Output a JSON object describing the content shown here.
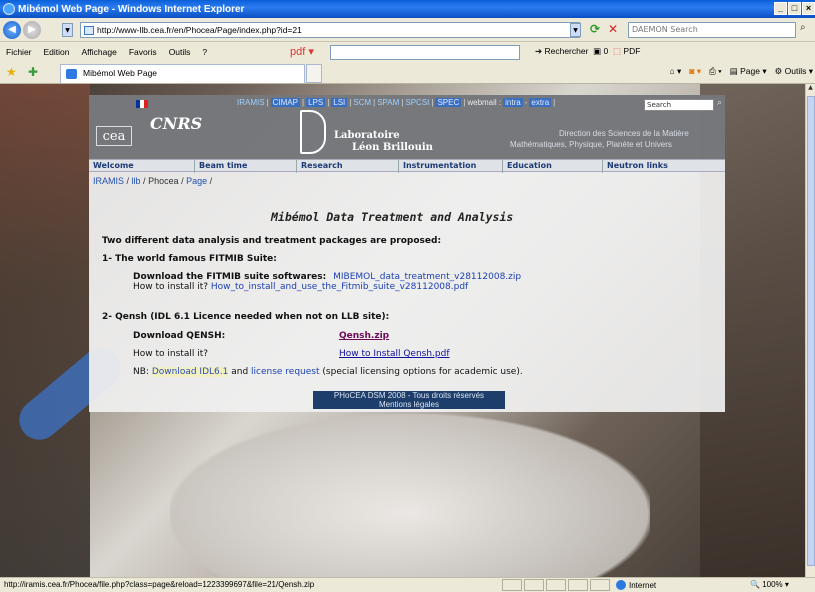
{
  "window": {
    "title": "Mibémol Web Page - Windows Internet Explorer"
  },
  "address": {
    "url": "http://www-llb.cea.fr/en/Phocea/Page/index.php?id=21",
    "search_placeholder": "DAEMON Search"
  },
  "menu": [
    "Fichier",
    "Edition",
    "Affichage",
    "Favoris",
    "Outils",
    "?"
  ],
  "pdf_label": "pdf",
  "rechercher": "Rechercher",
  "rechercher_count": "0",
  "pdf_btn": "PDF",
  "tab": {
    "title": "Mibémol Web Page"
  },
  "tools": {
    "page": "Page",
    "outils": "Outils"
  },
  "site_nav": {
    "links": [
      "IRAMIS",
      "CIMAP",
      "LPS",
      "LSI",
      "SCM",
      "SPAM",
      "SPCSI",
      "SPEC"
    ],
    "webmail": "webmail :",
    "intra": "intra",
    "extra": "extra",
    "search_value": "Search"
  },
  "header": {
    "cea": "cea",
    "cnrs": "CNRS",
    "lab_line1": "Laboratoire",
    "lab_line2": "Léon Brillouin",
    "dir_line1": "Direction des Sciences de la Matière",
    "dir_line2": "Mathématiques, Physique, Planète et Univers"
  },
  "main_nav": [
    "Welcome",
    "Beam time",
    "Research",
    "Instrumentation",
    "Education",
    "Neutron links"
  ],
  "breadcrumb": {
    "iramis": "IRAMIS",
    "llb": "llb",
    "phocea": "Phocea",
    "page": "Page"
  },
  "content": {
    "title": "Mibémol Data Treatment and Analysis",
    "intro": "Two different data analysis and treatment packages are proposed:",
    "sec1": "1- The world famous FITMIB Suite:",
    "download_fitmib_label": "Download the FITMIB suite softwares:",
    "download_fitmib_link": "MIBEMOL_data_treatment_v28112008.zip",
    "install_q1": "How to install it?",
    "install_link1": "How_to_install_and_use_the_Fitmib_suite_v28112008.pdf",
    "sec2": "2- Qensh (IDL 6.1 Licence needed when not on LLB site):",
    "download_qensh_label": "Download QENSH:",
    "qensh_link": "Qensh.zip",
    "install_q2": "How to install it?",
    "install_link2": "How to Install Qensh.pdf",
    "nb_prefix": "NB:",
    "nb_idl": "Download IDL6.1",
    "nb_and": "and",
    "nb_license": "license request",
    "nb_suffix": "(special licensing options for academic use)."
  },
  "footer": {
    "line1": "PHoCEA DSM 2008 - Tous droits réservés",
    "line2": "Mentions légales"
  },
  "status": {
    "text": "http://iramis.cea.fr/Phocea/file.php?class=page&reload=1223399697&file=21/Qensh.zip",
    "zone": "Internet",
    "zoom": "100%"
  }
}
